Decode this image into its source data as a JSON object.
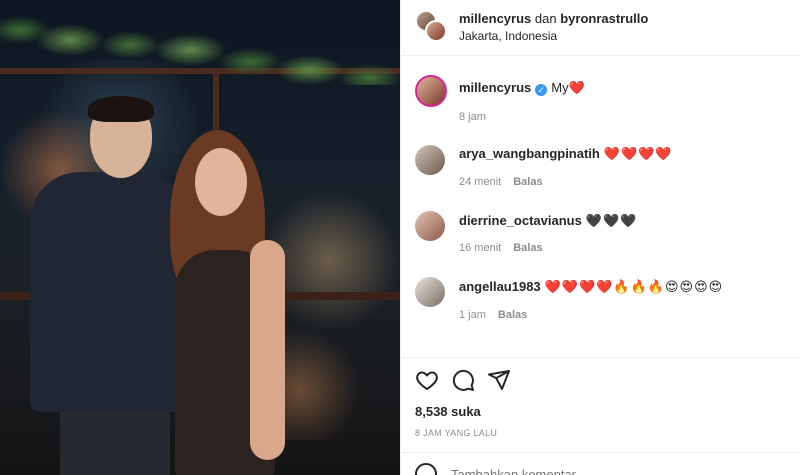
{
  "header": {
    "owner_1": "millencyrus",
    "joiner": "dan",
    "owner_2": "byronrastrullo",
    "location": "Jakarta, Indonesia"
  },
  "caption": {
    "username": "millencyrus",
    "text": "My",
    "emoji": "❤️",
    "time": "8 jam"
  },
  "comments": [
    {
      "username": "arya_wangbangpinatih",
      "text": "❤️❤️❤️❤️",
      "time": "24 menit",
      "reply": "Balas"
    },
    {
      "username": "dierrine_octavianus",
      "text": "🖤🖤🖤",
      "time": "16 menit",
      "reply": "Balas"
    },
    {
      "username": "angellau1983",
      "text": "❤️❤️❤️❤️🔥🔥🔥😍😍😍😍",
      "time": "1 jam",
      "reply": "Balas"
    }
  ],
  "stats": {
    "likes": "8,538 suka",
    "time_ago": "8 JAM YANG LALU"
  },
  "input": {
    "placeholder": "Tambahkan komentar..."
  },
  "icons": {
    "like": "heart-icon",
    "comment": "comment-icon",
    "share": "share-icon",
    "emoji": "emoji-icon"
  },
  "colors": {
    "verified": "#3897f0",
    "heart": "#ed4956",
    "meta": "#8e8e8e"
  }
}
